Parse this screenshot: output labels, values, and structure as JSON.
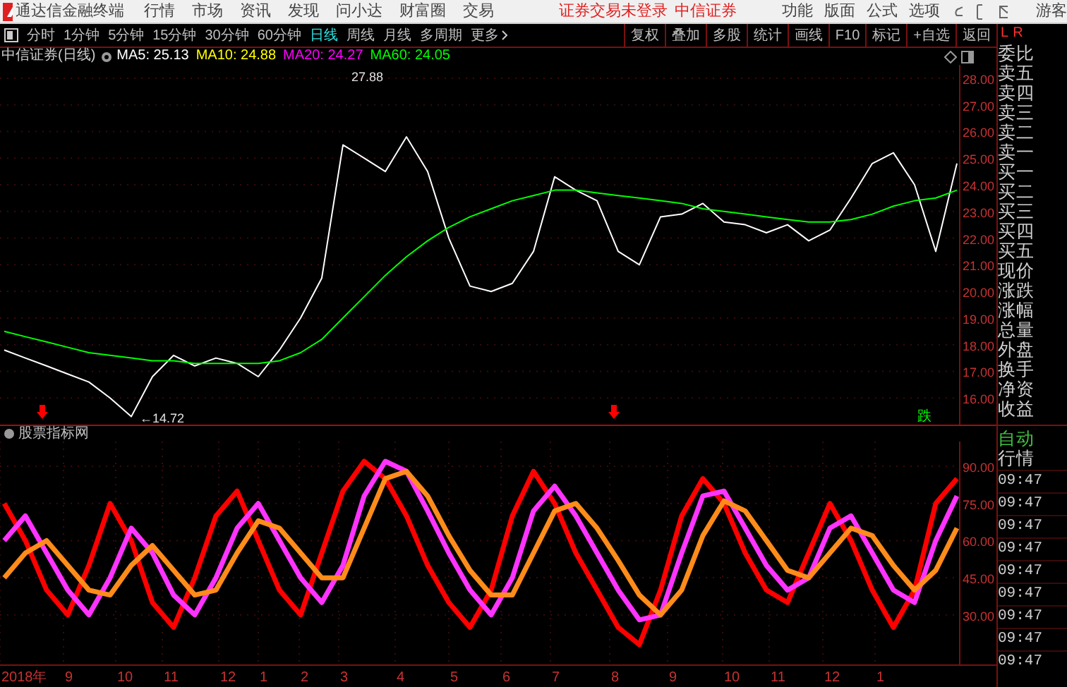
{
  "title_bar": {
    "app_title": "通达信金融终端",
    "menus": [
      "行情",
      "市场",
      "资讯",
      "发现",
      "问小达",
      "财富圈",
      "交易"
    ],
    "login_status": "证券交易未登录",
    "broker": "中信证券",
    "right_menus": [
      "功能",
      "版面",
      "公式",
      "选项"
    ],
    "user": "游客"
  },
  "toolbar": {
    "periods": [
      {
        "label": "分时",
        "selected": false
      },
      {
        "label": "1分钟",
        "selected": false
      },
      {
        "label": "5分钟",
        "selected": false
      },
      {
        "label": "15分钟",
        "selected": false
      },
      {
        "label": "30分钟",
        "selected": false
      },
      {
        "label": "60分钟",
        "selected": false
      },
      {
        "label": "日线",
        "selected": true
      },
      {
        "label": "周线",
        "selected": false
      },
      {
        "label": "月线",
        "selected": false
      },
      {
        "label": "多周期",
        "selected": false
      }
    ],
    "more": "更多",
    "buttons": [
      "复权",
      "叠加",
      "多股",
      "统计",
      "画线",
      "F10",
      "标记",
      "+自选",
      "返回"
    ]
  },
  "price_panel": {
    "stock": "中信证券(日线)",
    "legend": [
      {
        "label": "MA5: 25.13",
        "color": "#ffffff"
      },
      {
        "label": "MA10: 24.88",
        "color": "#ffff00"
      },
      {
        "label": "MA20: 24.27",
        "color": "#ff00ff"
      },
      {
        "label": "MA60: 24.05",
        "color": "#00ff00"
      }
    ],
    "chart_data": {
      "type": "line",
      "ylim": [
        15,
        28.5
      ],
      "yticks": [
        {
          "value": 16,
          "label": "16.00"
        },
        {
          "value": 17,
          "label": "17.00"
        },
        {
          "value": 18,
          "label": "18.00"
        },
        {
          "value": 19,
          "label": "19.00"
        },
        {
          "value": 20,
          "label": "20.00"
        },
        {
          "value": 21,
          "label": "21.00"
        },
        {
          "value": 22,
          "label": "22.00"
        },
        {
          "value": 23,
          "label": "23.00"
        },
        {
          "value": 24,
          "label": "24.00"
        },
        {
          "value": 25,
          "label": "25.00"
        },
        {
          "value": 26,
          "label": "26.00"
        },
        {
          "value": 27,
          "label": "27.00"
        },
        {
          "value": 28,
          "label": "28.00"
        }
      ],
      "series": [
        {
          "color": "#ffffff",
          "values": [
            17.8,
            17.5,
            17.2,
            16.9,
            16.6,
            16.0,
            15.3,
            16.8,
            17.6,
            17.2,
            17.5,
            17.3,
            16.8,
            17.8,
            19.0,
            20.5,
            25.5,
            25.0,
            24.5,
            25.8,
            24.5,
            22.0,
            20.2,
            20.0,
            20.3,
            21.5,
            24.3,
            23.8,
            23.4,
            21.5,
            21.0,
            22.8,
            22.9,
            23.3,
            22.6,
            22.5,
            22.2,
            22.5,
            21.9,
            22.3,
            23.5,
            24.8,
            25.2,
            24.0,
            21.5,
            24.8
          ]
        },
        {
          "color": "#00ff00",
          "values": [
            18.5,
            18.3,
            18.1,
            17.9,
            17.7,
            17.6,
            17.5,
            17.4,
            17.4,
            17.3,
            17.3,
            17.3,
            17.3,
            17.4,
            17.7,
            18.2,
            19.0,
            19.8,
            20.6,
            21.3,
            21.9,
            22.4,
            22.8,
            23.1,
            23.4,
            23.6,
            23.8,
            23.8,
            23.7,
            23.6,
            23.5,
            23.4,
            23.3,
            23.1,
            23.0,
            22.9,
            22.8,
            22.7,
            22.6,
            22.6,
            22.7,
            22.9,
            23.2,
            23.4,
            23.5,
            23.8
          ]
        }
      ],
      "grid": true,
      "annotations": [
        {
          "text": "27.88"
        },
        {
          "text": "←14.72"
        }
      ]
    },
    "signals": [
      {
        "kind": "arrow",
        "color": "#ff0000"
      },
      {
        "kind": "arrow",
        "color": "#ff0000"
      },
      {
        "kind": "text",
        "label": "跌",
        "color": "#00ff00"
      }
    ]
  },
  "indicator_panel": {
    "name": "股票指标网",
    "chart_data": {
      "type": "line",
      "ylim": [
        10,
        100
      ],
      "yticks": [
        {
          "value": 30,
          "label": "30.00"
        },
        {
          "value": 45,
          "label": "45.00"
        },
        {
          "value": 60,
          "label": "60.00"
        },
        {
          "value": 75,
          "label": "75.00"
        },
        {
          "value": 90,
          "label": "90.00"
        }
      ],
      "grid": true,
      "series": [
        {
          "color": "#ff0000",
          "values": [
            75,
            60,
            40,
            30,
            50,
            75,
            60,
            35,
            25,
            45,
            70,
            80,
            60,
            40,
            30,
            55,
            80,
            92,
            85,
            70,
            50,
            35,
            25,
            40,
            70,
            88,
            75,
            55,
            40,
            25,
            18,
            40,
            70,
            85,
            75,
            55,
            40,
            35,
            55,
            75,
            60,
            40,
            25,
            40,
            75,
            85
          ]
        },
        {
          "color": "#ff33ff",
          "values": [
            60,
            70,
            55,
            40,
            30,
            45,
            65,
            55,
            38,
            30,
            45,
            65,
            75,
            60,
            45,
            35,
            50,
            78,
            92,
            88,
            72,
            55,
            40,
            30,
            45,
            72,
            82,
            70,
            55,
            40,
            28,
            30,
            55,
            78,
            80,
            65,
            50,
            40,
            45,
            65,
            70,
            55,
            40,
            35,
            60,
            78
          ]
        },
        {
          "color": "#ff8c1a",
          "values": [
            45,
            55,
            60,
            50,
            40,
            38,
            50,
            58,
            48,
            38,
            40,
            55,
            68,
            65,
            55,
            45,
            45,
            65,
            85,
            88,
            78,
            62,
            48,
            38,
            38,
            55,
            72,
            75,
            65,
            52,
            38,
            30,
            40,
            62,
            76,
            72,
            60,
            48,
            45,
            55,
            65,
            62,
            50,
            40,
            48,
            65
          ]
        }
      ]
    },
    "x_axis_labels": [
      "2018年",
      "9",
      "10",
      "11",
      "12",
      "1",
      "2",
      "3",
      "4",
      "5",
      "6",
      "7",
      "8",
      "9",
      "10",
      "11",
      "12",
      "1"
    ]
  },
  "quote_panel": {
    "tab_l": "L",
    "tab_r": "R",
    "labels": [
      "委比",
      "卖五",
      "卖四",
      "卖三",
      "卖二",
      "卖一",
      "买一",
      "买二",
      "买三",
      "买四",
      "买五",
      "现价",
      "涨跌",
      "涨幅",
      "总量",
      "外盘",
      "换手",
      "净资",
      "收益"
    ],
    "auto": "自动",
    "market": "行情",
    "times": [
      "09:47",
      "09:47",
      "09:47",
      "09:47",
      "09:47",
      "09:47",
      "09:47",
      "09:47",
      "09:47"
    ]
  }
}
